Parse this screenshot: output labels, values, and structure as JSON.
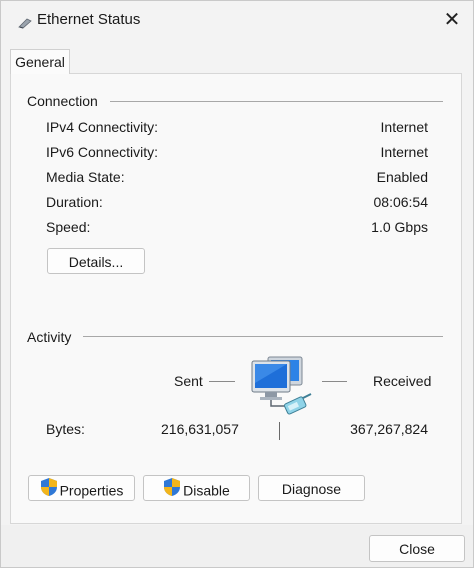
{
  "window": {
    "title": "Ethernet Status",
    "title_icon": "network-adapter-icon",
    "close_glyph": "✕"
  },
  "tabs": [
    {
      "label": "General",
      "active": true
    }
  ],
  "connection": {
    "heading": "Connection",
    "rows": [
      {
        "label": "IPv4 Connectivity:",
        "value": "Internet"
      },
      {
        "label": "IPv6 Connectivity:",
        "value": "Internet"
      },
      {
        "label": "Media State:",
        "value": "Enabled"
      },
      {
        "label": "Duration:",
        "value": "08:06:54"
      },
      {
        "label": "Speed:",
        "value": "1.0 Gbps"
      }
    ],
    "details_label": "Details..."
  },
  "activity": {
    "heading": "Activity",
    "sent_label": "Sent",
    "received_label": "Received",
    "bytes_label": "Bytes:",
    "bytes_sent": "216,631,057",
    "bytes_received": "367,267,824",
    "icon": "network-computers-icon"
  },
  "buttons": {
    "properties": "Properties",
    "disable": "Disable",
    "diagnose": "Diagnose",
    "close": "Close"
  },
  "colors": {
    "shield_blue": "#2f78d6",
    "shield_yellow": "#f2b51b",
    "monitor_blue": "#1e6fd9"
  }
}
